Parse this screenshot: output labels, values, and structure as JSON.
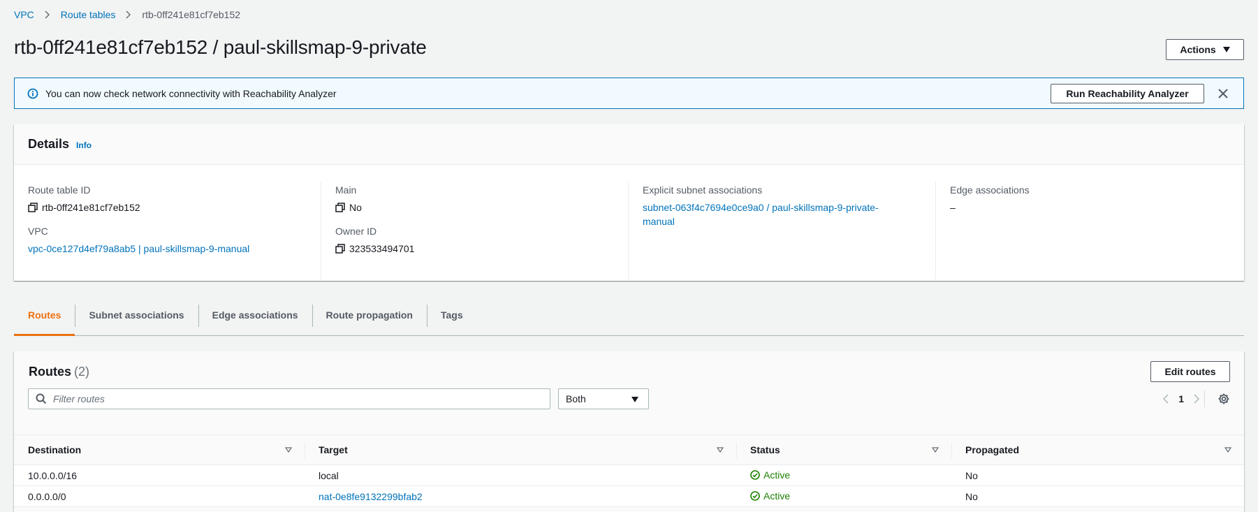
{
  "breadcrumb": {
    "items": [
      "VPC",
      "Route tables"
    ],
    "current": "rtb-0ff241e81cf7eb152"
  },
  "header": {
    "title": "rtb-0ff241e81cf7eb152 / paul-skillsmap-9-private",
    "actions_label": "Actions"
  },
  "flash": {
    "message": "You can now check network connectivity with Reachability Analyzer",
    "button_label": "Run Reachability Analyzer"
  },
  "details": {
    "title": "Details",
    "info_label": "Info",
    "route_table_id_label": "Route table ID",
    "route_table_id": "rtb-0ff241e81cf7eb152",
    "vpc_label": "VPC",
    "vpc_value": "vpc-0ce127d4ef79a8ab5 | paul-skillsmap-9-manual",
    "main_label": "Main",
    "main_value": "No",
    "owner_label": "Owner ID",
    "owner_value": "323533494701",
    "subnet_assoc_label": "Explicit subnet associations",
    "subnet_assoc_line1": "subnet-063f4c7694e0ce9a0 / paul-skillsmap-9-private-",
    "subnet_assoc_line2": "manual",
    "edge_assoc_label": "Edge associations",
    "edge_assoc_value": "–"
  },
  "tabs": [
    {
      "label": "Routes",
      "active": true
    },
    {
      "label": "Subnet associations",
      "active": false
    },
    {
      "label": "Edge associations",
      "active": false
    },
    {
      "label": "Route propagation",
      "active": false
    },
    {
      "label": "Tags",
      "active": false
    }
  ],
  "routes": {
    "title": "Routes",
    "count": "(2)",
    "edit_label": "Edit routes",
    "filter_placeholder": "Filter routes",
    "select_value": "Both",
    "page": "1",
    "columns": [
      "Destination",
      "Target",
      "Status",
      "Propagated"
    ],
    "rows": [
      {
        "destination": "10.0.0.0/16",
        "target": "local",
        "target_link": false,
        "status": "Active",
        "propagated": "No"
      },
      {
        "destination": "0.0.0.0/0",
        "target": "nat-0e8fe9132299bfab2",
        "target_link": true,
        "status": "Active",
        "propagated": "No"
      }
    ]
  },
  "colors": {
    "link": "#0073bb",
    "active_tab": "#ec7211",
    "status_ok": "#1d8102",
    "info_border": "#0073bb"
  }
}
